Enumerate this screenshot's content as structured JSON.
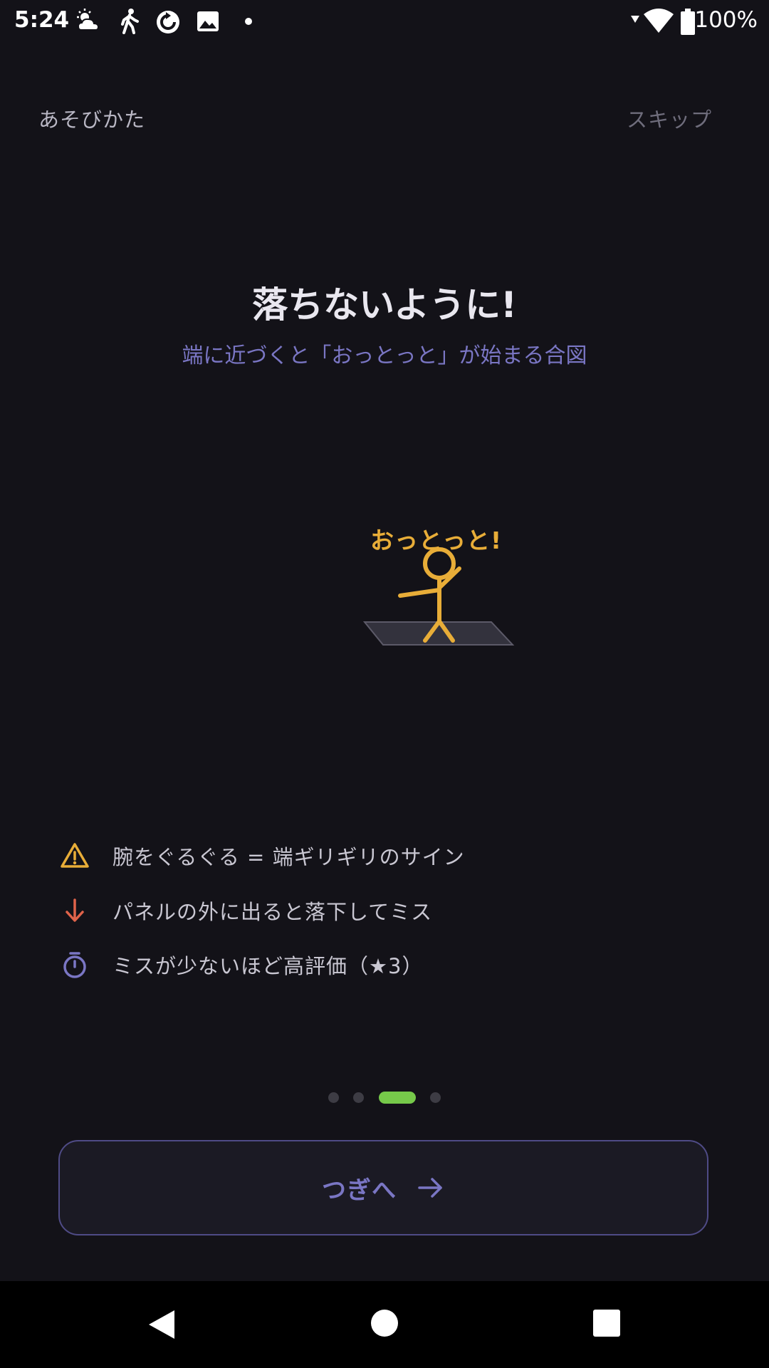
{
  "status_bar": {
    "time": "5:24",
    "battery": "100%",
    "icons": [
      "weather-cloud-sun-icon",
      "walking-icon",
      "refresh-icon",
      "image-icon",
      "dot-icon",
      "wifi-icon",
      "battery-icon"
    ]
  },
  "header": {
    "title": "あそびかた",
    "skip_label": "スキップ"
  },
  "main": {
    "headline": "落ちないように!",
    "subtitle": "端に近づくと「おっとっと」が始まる合図",
    "illustration_text": "おっとっと!"
  },
  "tips": [
    {
      "icon": "warning-icon",
      "text": "腕をぐるぐる = 端ギリギリのサイン",
      "color": "#e8ad38"
    },
    {
      "icon": "arrow-down-icon",
      "text": "パネルの外に出ると落下してミス",
      "color": "#e0634a"
    },
    {
      "icon": "stopwatch-icon",
      "text": "ミスが少ないほど高評価（★3）",
      "color": "#7a76c4"
    }
  ],
  "pagination": {
    "total": 4,
    "current": 3,
    "active_color": "#76c94a"
  },
  "next_button": {
    "label": "つぎへ"
  },
  "nav_bar": {
    "buttons": [
      "back-icon",
      "home-icon",
      "recents-icon"
    ]
  },
  "colors": {
    "background": "#131218",
    "accent": "#7a76c4",
    "warning": "#e8ad38"
  }
}
